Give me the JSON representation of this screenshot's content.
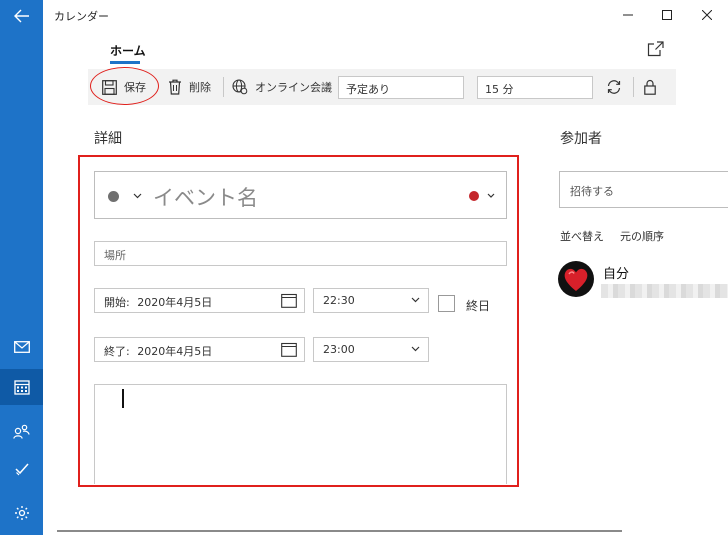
{
  "app": {
    "title": "カレンダー"
  },
  "window": {
    "minimize": "–",
    "maximize": "☐",
    "close": "✕"
  },
  "nav": {
    "back_icon": "back-arrow-icon",
    "items": [
      {
        "name": "mail",
        "icon": "mail-icon"
      },
      {
        "name": "calendar",
        "icon": "calendar-icon",
        "active": true
      },
      {
        "name": "people",
        "icon": "people-icon"
      },
      {
        "name": "todo",
        "icon": "todo-icon"
      },
      {
        "name": "settings",
        "icon": "gear-icon"
      }
    ]
  },
  "ribbon": {
    "active_tab": "ホーム"
  },
  "toolbar": {
    "save_label": "保存",
    "delete_label": "削除",
    "online_meeting_label": "オンライン会議",
    "show_as_value": "予定あり",
    "reminder_value": "15 分"
  },
  "details": {
    "heading": "詳細",
    "event_name_placeholder": "イベント名",
    "location_placeholder": "場所",
    "start_label": "開始:",
    "start_date": "2020年4月5日",
    "start_time": "22:30",
    "end_label": "終了:",
    "end_date": "2020年4月5日",
    "end_time": "23:00",
    "all_day_label": "終日",
    "all_day_checked": false
  },
  "attendees": {
    "heading": "参加者",
    "invite_placeholder": "招待する",
    "sort_label": "並べ替え",
    "sort_value": "元の順序",
    "self_name": "自分"
  },
  "colors": {
    "accent": "#1e73c8",
    "highlight": "#e0201c",
    "category_dot": "#c4262b"
  }
}
